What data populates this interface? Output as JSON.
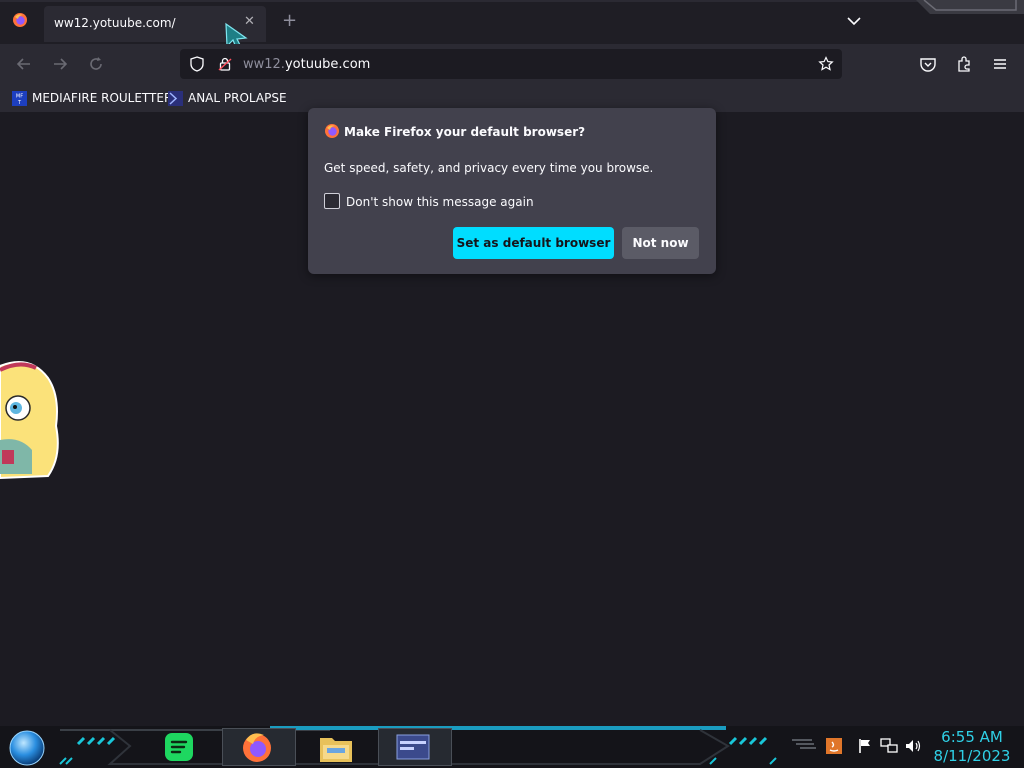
{
  "tab": {
    "title": "ww12.yotuube.com/",
    "close_glyph": "✕",
    "new_tab_glyph": "+"
  },
  "url": {
    "prefix": "ww12.",
    "host": "yotuube.com"
  },
  "bookmarks": [
    {
      "label": "MEDIAFIRE ROULETTER",
      "icon": "mediafire-icon"
    },
    {
      "label": "ANAL PROLAPSE",
      "icon": "bookmark-icon"
    }
  ],
  "popup": {
    "title": "Make Firefox your default browser?",
    "body": "Get speed, safety, and privacy every time you browse.",
    "checkbox_label": "Don't show this message again",
    "checkbox_checked": false,
    "primary_button": "Set as default browser",
    "secondary_button": "Not now"
  },
  "taskbar": {
    "time": "6:55 AM",
    "date": "8/11/2023",
    "apps": [
      "start-orb",
      "spotify-icon",
      "firefox-icon",
      "file-explorer-icon",
      "window-app-icon"
    ]
  },
  "colors": {
    "accent": "#00ddff",
    "page_background": "#1c1b22",
    "popup_background": "#42414d",
    "clock": "#2fd0e6"
  }
}
